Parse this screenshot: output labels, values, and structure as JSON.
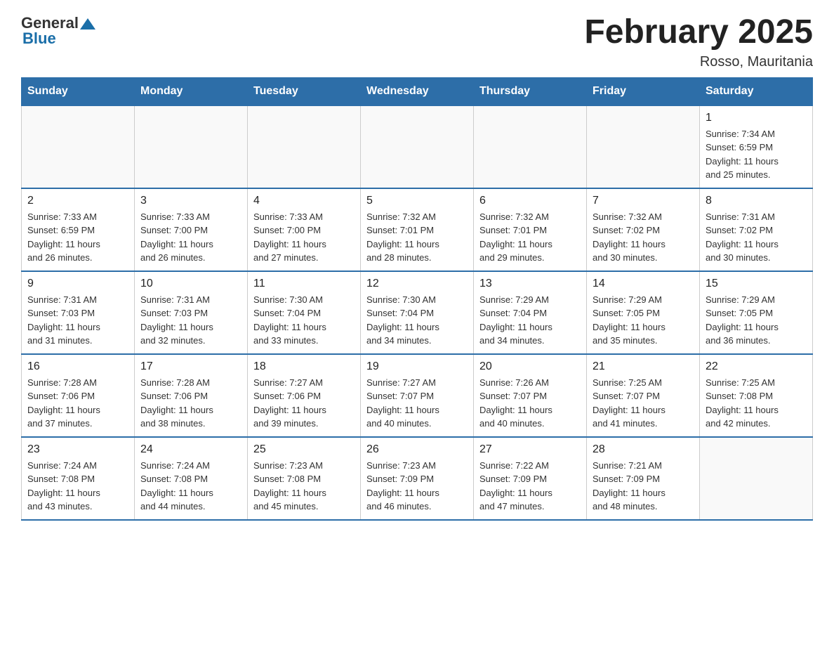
{
  "header": {
    "logo_general": "General",
    "logo_blue": "Blue",
    "month_title": "February 2025",
    "location": "Rosso, Mauritania"
  },
  "weekdays": [
    "Sunday",
    "Monday",
    "Tuesday",
    "Wednesday",
    "Thursday",
    "Friday",
    "Saturday"
  ],
  "weeks": [
    [
      {
        "day": "",
        "info": ""
      },
      {
        "day": "",
        "info": ""
      },
      {
        "day": "",
        "info": ""
      },
      {
        "day": "",
        "info": ""
      },
      {
        "day": "",
        "info": ""
      },
      {
        "day": "",
        "info": ""
      },
      {
        "day": "1",
        "info": "Sunrise: 7:34 AM\nSunset: 6:59 PM\nDaylight: 11 hours\nand 25 minutes."
      }
    ],
    [
      {
        "day": "2",
        "info": "Sunrise: 7:33 AM\nSunset: 6:59 PM\nDaylight: 11 hours\nand 26 minutes."
      },
      {
        "day": "3",
        "info": "Sunrise: 7:33 AM\nSunset: 7:00 PM\nDaylight: 11 hours\nand 26 minutes."
      },
      {
        "day": "4",
        "info": "Sunrise: 7:33 AM\nSunset: 7:00 PM\nDaylight: 11 hours\nand 27 minutes."
      },
      {
        "day": "5",
        "info": "Sunrise: 7:32 AM\nSunset: 7:01 PM\nDaylight: 11 hours\nand 28 minutes."
      },
      {
        "day": "6",
        "info": "Sunrise: 7:32 AM\nSunset: 7:01 PM\nDaylight: 11 hours\nand 29 minutes."
      },
      {
        "day": "7",
        "info": "Sunrise: 7:32 AM\nSunset: 7:02 PM\nDaylight: 11 hours\nand 30 minutes."
      },
      {
        "day": "8",
        "info": "Sunrise: 7:31 AM\nSunset: 7:02 PM\nDaylight: 11 hours\nand 30 minutes."
      }
    ],
    [
      {
        "day": "9",
        "info": "Sunrise: 7:31 AM\nSunset: 7:03 PM\nDaylight: 11 hours\nand 31 minutes."
      },
      {
        "day": "10",
        "info": "Sunrise: 7:31 AM\nSunset: 7:03 PM\nDaylight: 11 hours\nand 32 minutes."
      },
      {
        "day": "11",
        "info": "Sunrise: 7:30 AM\nSunset: 7:04 PM\nDaylight: 11 hours\nand 33 minutes."
      },
      {
        "day": "12",
        "info": "Sunrise: 7:30 AM\nSunset: 7:04 PM\nDaylight: 11 hours\nand 34 minutes."
      },
      {
        "day": "13",
        "info": "Sunrise: 7:29 AM\nSunset: 7:04 PM\nDaylight: 11 hours\nand 34 minutes."
      },
      {
        "day": "14",
        "info": "Sunrise: 7:29 AM\nSunset: 7:05 PM\nDaylight: 11 hours\nand 35 minutes."
      },
      {
        "day": "15",
        "info": "Sunrise: 7:29 AM\nSunset: 7:05 PM\nDaylight: 11 hours\nand 36 minutes."
      }
    ],
    [
      {
        "day": "16",
        "info": "Sunrise: 7:28 AM\nSunset: 7:06 PM\nDaylight: 11 hours\nand 37 minutes."
      },
      {
        "day": "17",
        "info": "Sunrise: 7:28 AM\nSunset: 7:06 PM\nDaylight: 11 hours\nand 38 minutes."
      },
      {
        "day": "18",
        "info": "Sunrise: 7:27 AM\nSunset: 7:06 PM\nDaylight: 11 hours\nand 39 minutes."
      },
      {
        "day": "19",
        "info": "Sunrise: 7:27 AM\nSunset: 7:07 PM\nDaylight: 11 hours\nand 40 minutes."
      },
      {
        "day": "20",
        "info": "Sunrise: 7:26 AM\nSunset: 7:07 PM\nDaylight: 11 hours\nand 40 minutes."
      },
      {
        "day": "21",
        "info": "Sunrise: 7:25 AM\nSunset: 7:07 PM\nDaylight: 11 hours\nand 41 minutes."
      },
      {
        "day": "22",
        "info": "Sunrise: 7:25 AM\nSunset: 7:08 PM\nDaylight: 11 hours\nand 42 minutes."
      }
    ],
    [
      {
        "day": "23",
        "info": "Sunrise: 7:24 AM\nSunset: 7:08 PM\nDaylight: 11 hours\nand 43 minutes."
      },
      {
        "day": "24",
        "info": "Sunrise: 7:24 AM\nSunset: 7:08 PM\nDaylight: 11 hours\nand 44 minutes."
      },
      {
        "day": "25",
        "info": "Sunrise: 7:23 AM\nSunset: 7:08 PM\nDaylight: 11 hours\nand 45 minutes."
      },
      {
        "day": "26",
        "info": "Sunrise: 7:23 AM\nSunset: 7:09 PM\nDaylight: 11 hours\nand 46 minutes."
      },
      {
        "day": "27",
        "info": "Sunrise: 7:22 AM\nSunset: 7:09 PM\nDaylight: 11 hours\nand 47 minutes."
      },
      {
        "day": "28",
        "info": "Sunrise: 7:21 AM\nSunset: 7:09 PM\nDaylight: 11 hours\nand 48 minutes."
      },
      {
        "day": "",
        "info": ""
      }
    ]
  ]
}
